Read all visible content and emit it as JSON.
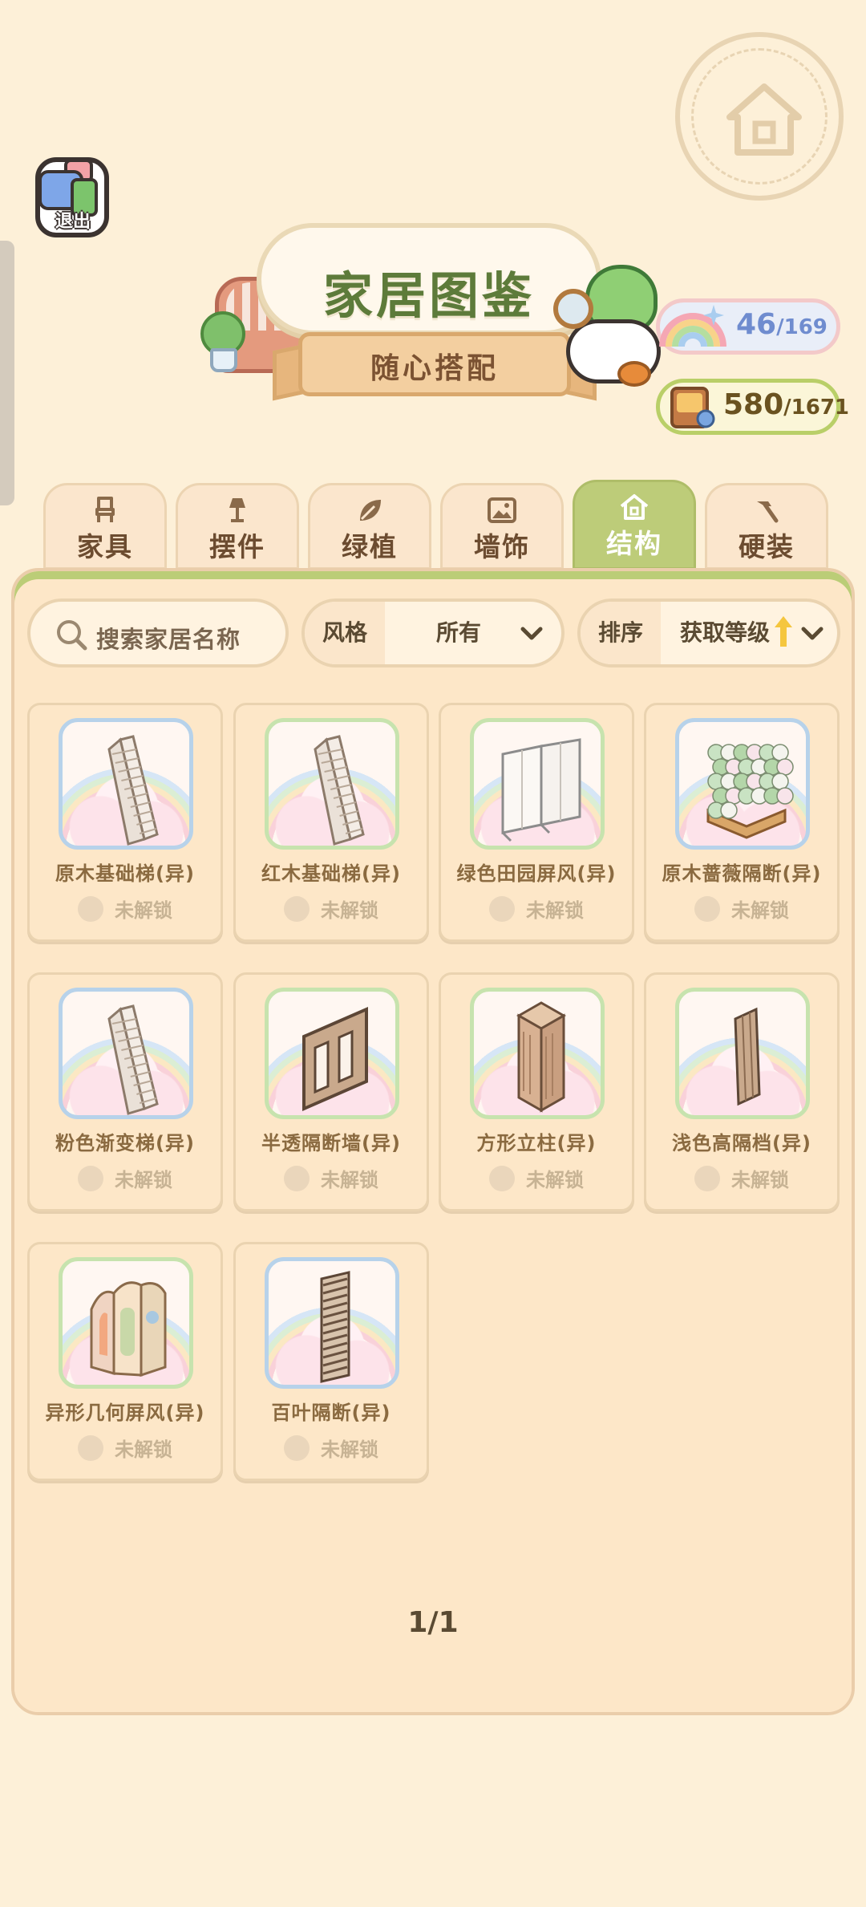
{
  "header": {
    "exit_label": "退出",
    "title": "家居图鉴",
    "subtitle": "随心搭配"
  },
  "counters": {
    "rainbow": {
      "current": "46",
      "total": "/169"
    },
    "book": {
      "current": "580",
      "total": "/1671"
    }
  },
  "tabs": [
    {
      "label": "家具",
      "icon": "chair-icon",
      "active": false
    },
    {
      "label": "摆件",
      "icon": "lamp-icon",
      "active": false
    },
    {
      "label": "绿植",
      "icon": "leaf-icon",
      "active": false
    },
    {
      "label": "墙饰",
      "icon": "picture-frame-icon",
      "active": false
    },
    {
      "label": "结构",
      "icon": "house-icon",
      "active": true
    },
    {
      "label": "硬装",
      "icon": "hammer-icon",
      "active": false
    }
  ],
  "filters": {
    "search_placeholder": "搜索家居名称",
    "style_label": "风格",
    "style_value": "所有",
    "sort_label": "排序",
    "sort_value": "获取等级"
  },
  "items": [
    {
      "name": "原木基础梯(异)",
      "status": "未解锁",
      "frame": "blue",
      "icon": "staircase-icon"
    },
    {
      "name": "红木基础梯(异)",
      "status": "未解锁",
      "frame": "green",
      "icon": "staircase-icon"
    },
    {
      "name": "绿色田园屏风(异)",
      "status": "未解锁",
      "frame": "green",
      "icon": "folding-screen-icon"
    },
    {
      "name": "原木蔷薇隔断(异)",
      "status": "未解锁",
      "frame": "blue",
      "icon": "rose-partition-icon"
    },
    {
      "name": "粉色渐变梯(异)",
      "status": "未解锁",
      "frame": "blue",
      "icon": "staircase-icon"
    },
    {
      "name": "半透隔断墙(异)",
      "status": "未解锁",
      "frame": "green",
      "icon": "partition-wall-icon"
    },
    {
      "name": "方形立柱(异)",
      "status": "未解锁",
      "frame": "green",
      "icon": "square-pillar-icon"
    },
    {
      "name": "浅色高隔档(异)",
      "status": "未解锁",
      "frame": "green",
      "icon": "tall-divider-icon"
    },
    {
      "name": "异形几何屏风(异)",
      "status": "未解锁",
      "frame": "green",
      "icon": "geometric-screen-icon"
    },
    {
      "name": "百叶隔断(异)",
      "status": "未解锁",
      "frame": "blue",
      "icon": "louver-partition-icon"
    }
  ],
  "pagination": "1/1",
  "colors": {
    "background": "#fdf0d8",
    "active_tab": "#bdcc79",
    "title_green": "#5d7b3a",
    "rainbow_counter": "#6f8ccf"
  }
}
